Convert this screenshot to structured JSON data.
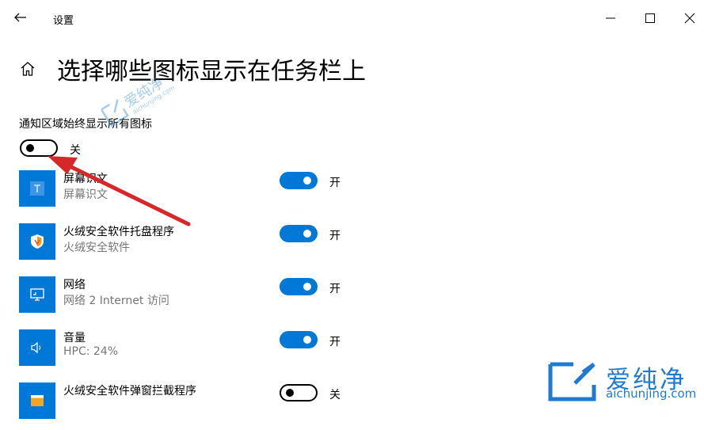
{
  "window": {
    "title": "设置"
  },
  "page": {
    "title": "选择哪些图标显示在任务栏上"
  },
  "always_show": {
    "label": "通知区域始终显示所有图标",
    "state": "关",
    "on": false
  },
  "items": [
    {
      "name": "屏幕识文",
      "subtitle": "屏幕识文",
      "state": "开",
      "on": true,
      "icon": "ocr-text-icon"
    },
    {
      "name": "火绒安全软件托盘程序",
      "subtitle": "火绒安全软件",
      "state": "开",
      "on": true,
      "icon": "shield-icon"
    },
    {
      "name": "网络",
      "subtitle": "网络 2 Internet 访问",
      "state": "开",
      "on": true,
      "icon": "network-monitor-icon"
    },
    {
      "name": "音量",
      "subtitle": "HPC: 24%",
      "state": "开",
      "on": true,
      "icon": "speaker-icon"
    },
    {
      "name": "火绒安全软件弹窗拦截程序",
      "subtitle": "",
      "state": "关",
      "on": false,
      "icon": "popup-block-icon"
    }
  ],
  "watermark": {
    "small_text": "爱纯净",
    "small_url": "aichunjing.com",
    "brand_text": "爱纯净",
    "brand_url": "aichunjing.com"
  },
  "colors": {
    "accent": "#0078d7",
    "annotation_arrow": "#d62828",
    "watermark": "#1f7ad1"
  }
}
